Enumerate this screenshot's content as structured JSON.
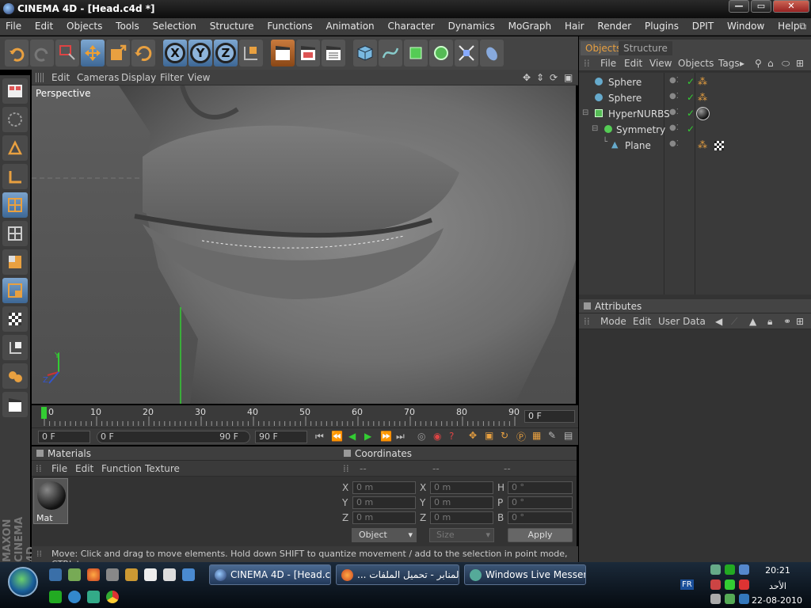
{
  "window": {
    "title": "CINEMA 4D - [Head.c4d *]",
    "buttons": {
      "minimize": "—",
      "maximize": "▭",
      "close": "✕"
    }
  },
  "menubar": [
    "File",
    "Edit",
    "Objects",
    "Tools",
    "Selection",
    "Structure",
    "Functions",
    "Animation",
    "Character",
    "Dynamics",
    "MoGraph",
    "Hair",
    "Render",
    "Plugins",
    "DPIT",
    "Window",
    "Help"
  ],
  "toolbar": {
    "axis_x": "X",
    "axis_y": "Y",
    "axis_z": "Z"
  },
  "viewport": {
    "menu": [
      "Edit",
      "Cameras",
      "Display",
      "Filter",
      "View"
    ],
    "label": "Perspective",
    "axis_y": "Y",
    "axis_z": "Z"
  },
  "timeline": {
    "ticks": [
      "0",
      "10",
      "20",
      "30",
      "40",
      "50",
      "60",
      "70",
      "80",
      "90"
    ],
    "current_frame": "0 F",
    "start_field": "0 F",
    "range_start": "0 F",
    "range_end": "90 F",
    "end_field": "90 F"
  },
  "materials": {
    "title": "Materials",
    "menu": [
      "File",
      "Edit",
      "Function",
      "Texture"
    ],
    "items": [
      {
        "name": "Mat"
      }
    ]
  },
  "coordinates": {
    "title": "Coordinates",
    "col_headers": [
      "--",
      "--",
      "--"
    ],
    "rows": [
      {
        "a": "X",
        "av": "0 m",
        "b": "X",
        "bv": "0 m",
        "c": "H",
        "cv": "0 °"
      },
      {
        "a": "Y",
        "av": "0 m",
        "b": "Y",
        "bv": "0 m",
        "c": "P",
        "cv": "0 °"
      },
      {
        "a": "Z",
        "av": "0 m",
        "b": "Z",
        "bv": "0 m",
        "c": "B",
        "cv": "0 °"
      }
    ],
    "mode_select": "Object",
    "size_select": "Size",
    "apply_label": "Apply"
  },
  "status": "Move: Click and drag to move elements. Hold down SHIFT to quantize movement / add to the selection in point mode, CTRL to remove.",
  "objects_panel": {
    "tabs": [
      "Objects",
      "Structure"
    ],
    "menu": [
      "File",
      "Edit",
      "View",
      "Objects",
      "Tags"
    ],
    "tree": [
      {
        "name": "Sphere",
        "indent": 0
      },
      {
        "name": "Sphere",
        "indent": 0
      },
      {
        "name": "HyperNURBS",
        "indent": 0
      },
      {
        "name": "Symmetry",
        "indent": 1
      },
      {
        "name": "Plane",
        "indent": 2
      }
    ]
  },
  "attributes_panel": {
    "title": "Attributes",
    "menu": [
      "Mode",
      "Edit",
      "User Data"
    ]
  },
  "taskbar": {
    "tasks": [
      {
        "label": "CINEMA 4D - [Head.c..."
      },
      {
        "label": "... المنابر - تحميل الملفات"
      },
      {
        "label": "Windows Live Messenger"
      }
    ],
    "language": "FR",
    "time": "20:21",
    "day": "الأحد",
    "date": "22-08-2010"
  },
  "colors": {
    "accent_orange": "#e8a040",
    "tool_blue": "#6f9cc8",
    "panel_bg": "#333333"
  }
}
